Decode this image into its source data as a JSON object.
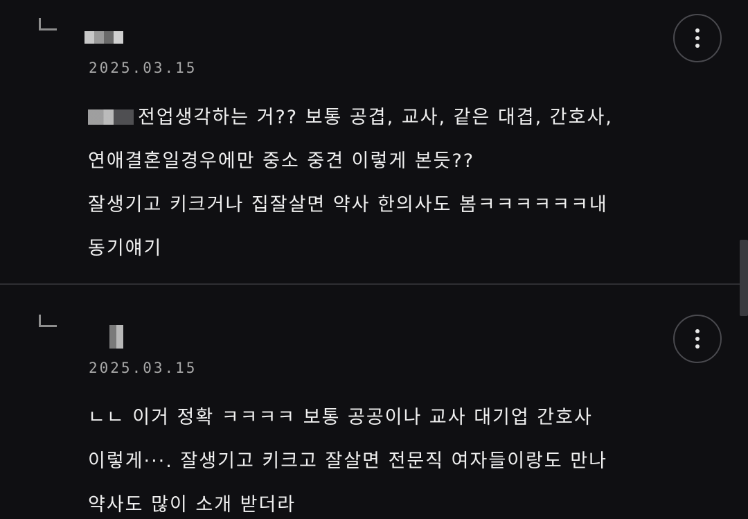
{
  "comments": [
    {
      "date": "2025.03.15",
      "lines": [
        "전업생각하는 거?? 보통 공겹, 교사, 같은 대겹, 간호사,",
        "연애결혼일경우에만 중소 중견 이렇게 본듯??",
        "잘생기고 키크거나 집잘살면 약사 한의사도 봄ㅋㅋㅋㅋㅋㅋ내",
        "동기얘기"
      ]
    },
    {
      "date": "2025.03.15",
      "lines": [
        "ㄴㄴ 이거 정확 ㅋㅋㅋㅋ 보통 공공이나 교사 대기업 간호사",
        "이렇게···. 잘생기고 키크고 잘살면 전문직 여자들이랑도 만나",
        "약사도 많이 소개 받더라"
      ]
    }
  ],
  "icons": {
    "reply": "reply-arrow-icon",
    "more": "more-vertical-icon"
  },
  "colors": {
    "background": "#0f0f12",
    "text": "#f0f0f0",
    "date": "#a9a9a9",
    "divider": "#2e2e33"
  }
}
